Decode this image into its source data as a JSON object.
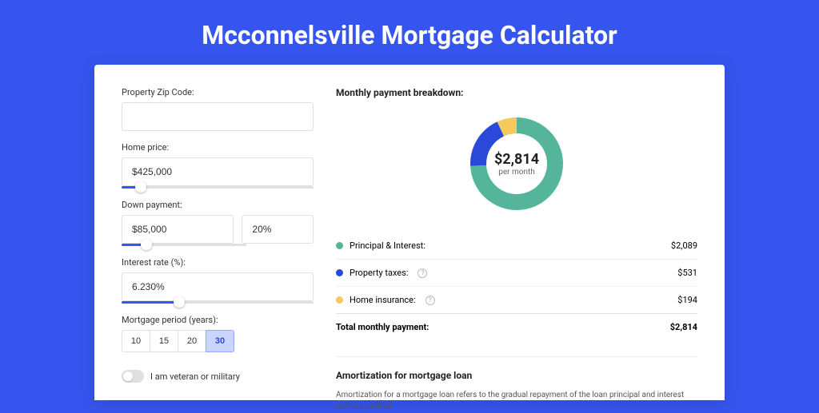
{
  "title": "Mcconnelsville Mortgage Calculator",
  "form": {
    "zip_label": "Property Zip Code:",
    "zip_value": "",
    "home_price_label": "Home price:",
    "home_price_value": "$425,000",
    "home_price_slider_percent": 10,
    "down_payment_label": "Down payment:",
    "down_payment_value": "$85,000",
    "down_payment_percent": "20%",
    "down_payment_slider_percent": 20,
    "interest_label": "Interest rate (%):",
    "interest_value": "6.230%",
    "interest_slider_percent": 30,
    "period_label": "Mortgage period (years):",
    "periods": [
      "10",
      "15",
      "20",
      "30"
    ],
    "period_active": "30",
    "veteran_label": "I am veteran or military"
  },
  "breakdown": {
    "header": "Monthly payment breakdown:",
    "center_amount": "$2,814",
    "center_sub": "per month",
    "rows": [
      {
        "label": "Principal & Interest:",
        "value": "$2,089",
        "color": "green",
        "info": false
      },
      {
        "label": "Property taxes:",
        "value": "$531",
        "color": "blue",
        "info": true
      },
      {
        "label": "Home insurance:",
        "value": "$194",
        "color": "yellow",
        "info": true
      }
    ],
    "total_label": "Total monthly payment:",
    "total_value": "$2,814"
  },
  "chart_data": {
    "type": "pie",
    "title": "Monthly payment breakdown",
    "series": [
      {
        "name": "Principal & Interest",
        "value": 2089,
        "color": "#54b59a"
      },
      {
        "name": "Property taxes",
        "value": 531,
        "color": "#2a49d8"
      },
      {
        "name": "Home insurance",
        "value": 194,
        "color": "#f4c95d"
      }
    ],
    "total": 2814
  },
  "amortization": {
    "header": "Amortization for mortgage loan",
    "text": "Amortization for a mortgage loan refers to the gradual repayment of the loan principal and interest over a specified"
  }
}
